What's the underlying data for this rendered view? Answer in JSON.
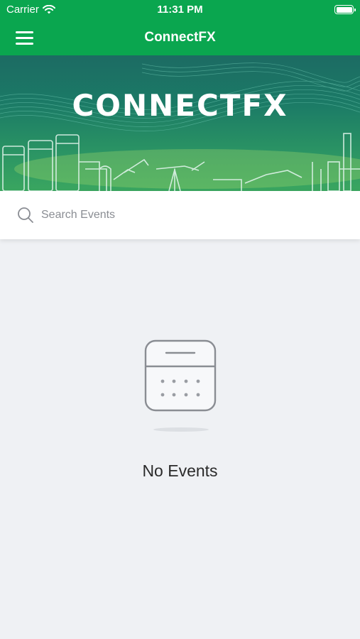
{
  "status_bar": {
    "carrier": "Carrier",
    "time": "11:31 PM"
  },
  "nav": {
    "title": "ConnectFX",
    "menu_icon": "hamburger-menu-icon"
  },
  "banner": {
    "title": "CONNECTFX"
  },
  "search": {
    "placeholder": "Search Events",
    "value": ""
  },
  "empty_state": {
    "message": "No Events",
    "icon": "calendar-icon"
  },
  "colors": {
    "brand_green": "#0aa64f",
    "background": "#eff1f4"
  }
}
